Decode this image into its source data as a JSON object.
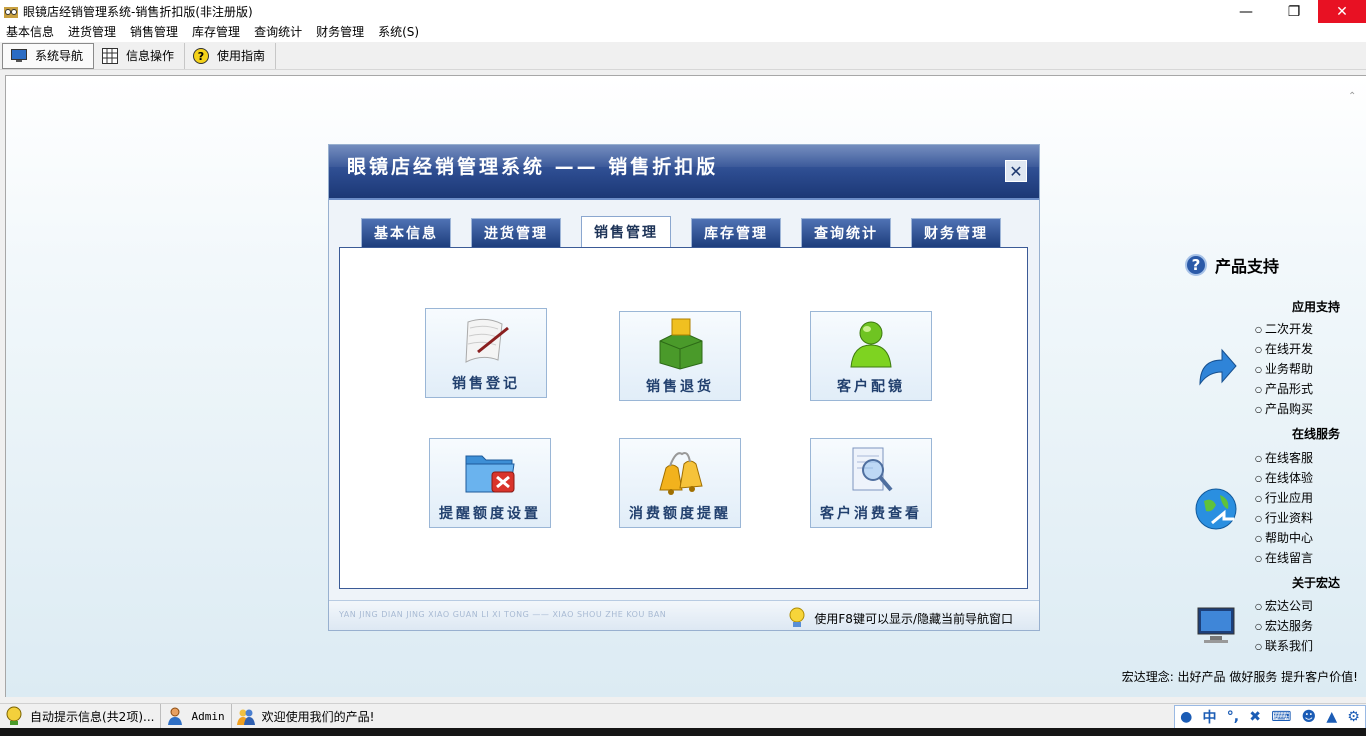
{
  "window": {
    "title": "眼镜店经销管理系统-销售折扣版(非注册版)"
  },
  "menu": [
    "基本信息",
    "进货管理",
    "销售管理",
    "库存管理",
    "查询统计",
    "财务管理",
    "系统(S)"
  ],
  "toolbar": [
    {
      "label": "系统导航",
      "icon": "monitor-icon"
    },
    {
      "label": "信息操作",
      "icon": "grid-icon"
    },
    {
      "label": "使用指南",
      "icon": "help-icon"
    }
  ],
  "dialog": {
    "title": "眼镜店经销管理系统 —— 销售折扣版",
    "tabs": [
      "基本信息",
      "进货管理",
      "销售管理",
      "库存管理",
      "查询统计",
      "财务管理"
    ],
    "active_tab": "销售管理",
    "functions": [
      {
        "label": "销售登记",
        "icon": "scroll-icon"
      },
      {
        "label": "销售退货",
        "icon": "box-return-icon"
      },
      {
        "label": "客户配镜",
        "icon": "user-icon"
      },
      {
        "label": "提醒额度设置",
        "icon": "folder-tools-icon"
      },
      {
        "label": "消费额度提醒",
        "icon": "bells-icon"
      },
      {
        "label": "客户消费查看",
        "icon": "magnifier-doc-icon"
      }
    ],
    "footer_pinyin": "YAN JING DIAN JING XIAO GUAN LI XI TONG —— XIAO SHOU ZHE KOU BAN",
    "footer_hint": "使用F8键可以显示/隐藏当前导航窗口"
  },
  "support": {
    "title": "产品支持",
    "sections": [
      {
        "heading": "应用支持",
        "items": [
          "二次开发",
          "在线开发",
          "业务帮助",
          "产品形式",
          "产品购买"
        ]
      },
      {
        "heading": "在线服务",
        "items": [
          "在线客服",
          "在线体验",
          "行业应用",
          "行业资料",
          "帮助中心",
          "在线留言"
        ]
      },
      {
        "heading": "关于宏达",
        "items": [
          "宏达公司",
          "宏达服务",
          "联系我们"
        ]
      }
    ],
    "motto": "宏达理念: 出好产品  做好服务  提升客户价值!"
  },
  "status": {
    "tips": "自动提示信息(共2项)...",
    "user": "Admin",
    "welcome": "欢迎使用我们的产品!",
    "ime_mode": "中"
  },
  "colors": {
    "header": "#2b4a8e",
    "close_hover": "#e81123",
    "link": "#22406e"
  }
}
